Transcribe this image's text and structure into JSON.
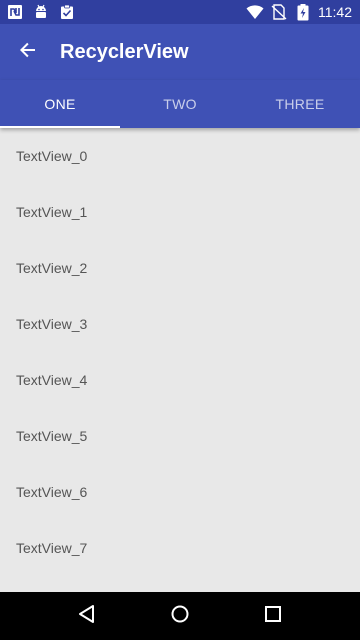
{
  "status_bar": {
    "time": "11:42",
    "left_icons": [
      "nfc-icon",
      "android-debug-icon",
      "clipboard-check-icon"
    ],
    "right_icons": [
      "wifi-icon",
      "no-sim-icon",
      "battery-charging-icon"
    ]
  },
  "app_bar": {
    "title": "RecyclerView",
    "back_icon": "arrow-back-icon"
  },
  "tabs": [
    {
      "label": "ONE",
      "active": true
    },
    {
      "label": "TWO",
      "active": false
    },
    {
      "label": "THREE",
      "active": false
    }
  ],
  "list": {
    "items": [
      "TextView_0",
      "TextView_1",
      "TextView_2",
      "TextView_3",
      "TextView_4",
      "TextView_5",
      "TextView_6",
      "TextView_7"
    ]
  },
  "nav_bar": {
    "buttons": [
      "back-triangle-icon",
      "home-circle-icon",
      "recents-square-icon"
    ]
  },
  "colors": {
    "status_bar": "#303f9f",
    "primary": "#3f51b5",
    "background": "#e8e8e8",
    "list_text": "#555555"
  }
}
